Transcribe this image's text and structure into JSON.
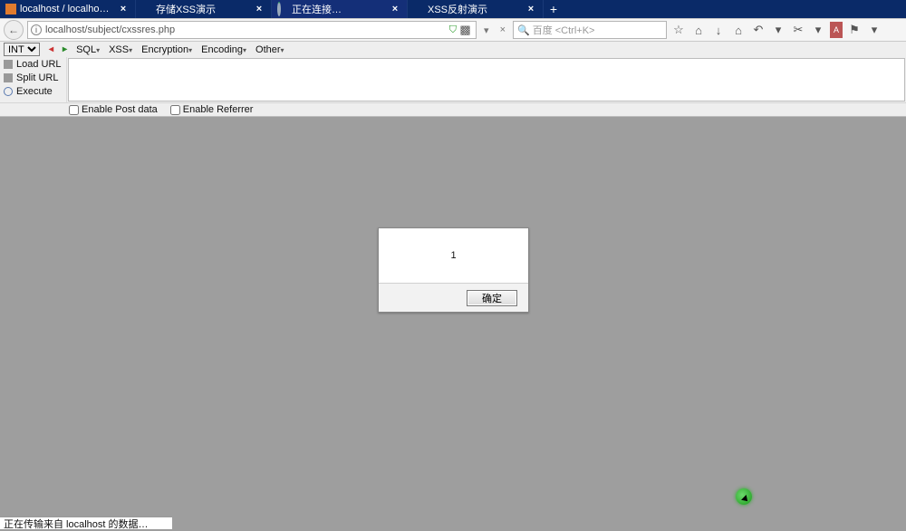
{
  "tabs": [
    {
      "label": "localhost / localhost /…",
      "icon": "fav-orange",
      "active": false
    },
    {
      "label": "存储XSS演示",
      "icon": "",
      "active": false
    },
    {
      "label": "正在连接…",
      "icon": "fav-spin",
      "active": true
    },
    {
      "label": "XSS反射演示",
      "icon": "",
      "active": false
    }
  ],
  "nav": {
    "back": "←",
    "url": "localhost/subject/cxssres.php",
    "search_placeholder": "百度 <Ctrl+K>"
  },
  "hackbar": {
    "select": "INT",
    "menu": {
      "sql": "SQL",
      "xss": "XSS",
      "encryption": "Encryption",
      "encoding": "Encoding",
      "other": "Other"
    },
    "side": {
      "load": "Load URL",
      "split": "Split URL",
      "execute": "Execute"
    },
    "checks": {
      "post": "Enable Post data",
      "referrer": "Enable Referrer"
    }
  },
  "dialog": {
    "message": "1",
    "ok": "确定"
  },
  "status": "正在传输来自 localhost 的数据…"
}
